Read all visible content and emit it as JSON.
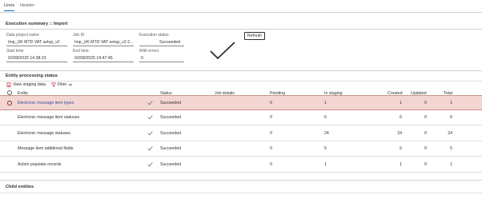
{
  "tabs": [
    {
      "label": "Lines",
      "active": true
    },
    {
      "label": "Header",
      "active": false
    }
  ],
  "summary": {
    "title": "Execution summary :: Import",
    "fields": {
      "data_project_name": {
        "label": "Data project name",
        "value": "Imp_UK MTD VAT setup_v2"
      },
      "job_id": {
        "label": "Job ID",
        "value": "Imp_UK MTD VAT setup_v2-2..."
      },
      "execution_status": {
        "label": "Execution status",
        "value": "Succeeded"
      },
      "start_time": {
        "label": "Start time",
        "value": "02/08/2025 14:38:23"
      },
      "end_time": {
        "label": "End time",
        "value": "02/08/2025 14:47:45"
      },
      "with_errors": {
        "label": "With errors",
        "value": "0"
      }
    },
    "refresh_label": "Refresh"
  },
  "entity_status": {
    "title": "Entity processing status",
    "toolbar": {
      "view_staging_label": "View staging data",
      "filter_label": "Filter"
    },
    "columns": {
      "entity": "Entity",
      "status": "Status",
      "job_details": "Job details",
      "pending": "Pending",
      "in_staging": "In staging",
      "created": "Created",
      "updated": "Updated",
      "total": "Total"
    },
    "rows": [
      {
        "entity": "Electronic message item types",
        "status": "Succeeded",
        "job_details": "",
        "pending": "0",
        "in_staging": "1",
        "created": "1",
        "updated": "0",
        "total": "1"
      },
      {
        "entity": "Electronic message item statuses",
        "status": "Succeeded",
        "job_details": "",
        "pending": "0",
        "in_staging": "6",
        "created": "6",
        "updated": "0",
        "total": "6"
      },
      {
        "entity": "Electronic message statuses",
        "status": "Succeeded",
        "job_details": "",
        "pending": "0",
        "in_staging": "24",
        "created": "24",
        "updated": "0",
        "total": "24"
      },
      {
        "entity": "Message item additional fields",
        "status": "Succeeded",
        "job_details": "",
        "pending": "0",
        "in_staging": "5",
        "created": "5",
        "updated": "0",
        "total": "5"
      },
      {
        "entity": "Action populate records",
        "status": "Succeeded",
        "job_details": "",
        "pending": "0",
        "in_staging": "1",
        "created": "1",
        "updated": "0",
        "total": "1"
      }
    ]
  },
  "child_entities": {
    "title": "Child entities"
  },
  "icons": {
    "big_check": "checkmark-icon",
    "row_check": "checkmark-icon",
    "view_staging": "document-icon",
    "filter": "filter-icon"
  },
  "colors": {
    "accent": "#0f6cbd",
    "selected_row_bg": "#f3d5d1",
    "link": "#3a52a8",
    "icon_red": "#c4314b"
  }
}
